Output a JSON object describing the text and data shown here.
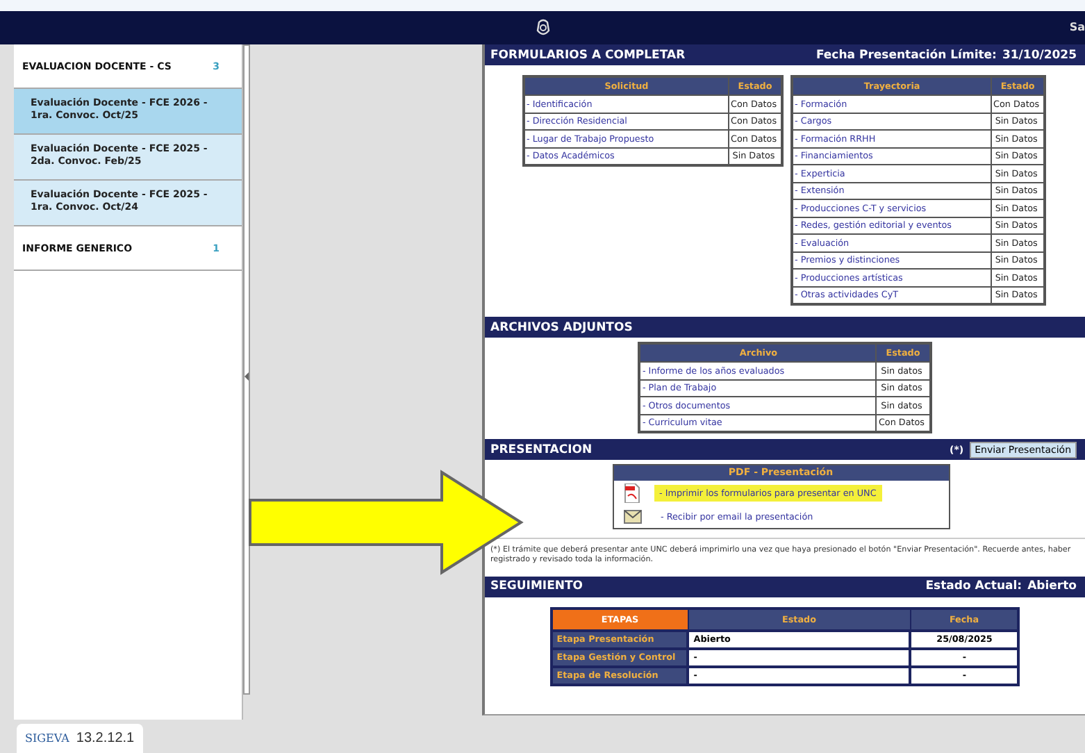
{
  "header": {
    "user_text": "Sa"
  },
  "sidebar": {
    "items": [
      {
        "kind": "group",
        "label": "EVALUACION DOCENTE - CS",
        "count": "3"
      },
      {
        "kind": "item",
        "label": "Evaluación Docente - FCE 2026 - 1ra. Convoc. Oct/25",
        "selected": true
      },
      {
        "kind": "item",
        "label": "Evaluación Docente - FCE 2025 - 2da. Convoc. Feb/25",
        "selected": false
      },
      {
        "kind": "item",
        "label": "Evaluación Docente - FCE 2025 - 1ra. Convoc. Oct/24",
        "selected": false
      },
      {
        "kind": "group",
        "label": "INFORME GENERICO",
        "count": "1"
      }
    ]
  },
  "forms": {
    "title": "FORMULARIOS A COMPLETAR",
    "deadline_label": "Fecha Presentación Límite:",
    "deadline": "31/10/2025",
    "tables": [
      {
        "columns": [
          "Solicitud",
          "Estado"
        ],
        "rows": [
          {
            "name": "- Identificación",
            "status": "Con Datos"
          },
          {
            "name": "- Dirección Residencial",
            "status": "Con Datos"
          },
          {
            "name": "- Lugar de Trabajo Propuesto",
            "status": "Con Datos"
          },
          {
            "name": "- Datos Académicos",
            "status": "Sin Datos"
          }
        ]
      },
      {
        "columns": [
          "Trayectoria",
          "Estado"
        ],
        "rows": [
          {
            "name": "- Formación",
            "status": "Con Datos"
          },
          {
            "name": "- Cargos",
            "status": "Sin Datos"
          },
          {
            "name": "- Formación RRHH",
            "status": "Sin Datos"
          },
          {
            "name": "- Financiamientos",
            "status": "Sin Datos"
          },
          {
            "name": "- Experticia",
            "status": "Sin Datos"
          },
          {
            "name": "- Extensión",
            "status": "Sin Datos"
          },
          {
            "name": "- Producciones C-T y servicios",
            "status": "Sin Datos"
          },
          {
            "name": "- Redes, gestión editorial y eventos",
            "status": "Sin Datos"
          },
          {
            "name": "- Evaluación",
            "status": "Sin Datos"
          },
          {
            "name": "- Premios y distinciones",
            "status": "Sin Datos"
          },
          {
            "name": "- Producciones artísticas",
            "status": "Sin Datos"
          },
          {
            "name": "- Otras actividades CyT",
            "status": "Sin Datos"
          }
        ]
      }
    ]
  },
  "attachments": {
    "title": "ARCHIVOS ADJUNTOS",
    "columns": [
      "Archivo",
      "Estado"
    ],
    "rows": [
      {
        "name": "- Informe de los años evaluados",
        "status": "Sin datos"
      },
      {
        "name": "- Plan de Trabajo",
        "status": "Sin datos"
      },
      {
        "name": "- Otros documentos",
        "status": "Sin datos"
      },
      {
        "name": "- Curriculum vitae",
        "status": "Con Datos"
      }
    ]
  },
  "presentation": {
    "title": "PRESENTACION",
    "note_mark": "(*)",
    "button": "Enviar Presentación",
    "box_title": "PDF - Presentación",
    "links": [
      {
        "kind": "pdf",
        "label": "- Imprimir los formularios para presentar en UNC",
        "highlighted": true
      },
      {
        "kind": "email",
        "label": "- Recibir por email la presentación",
        "highlighted": false
      }
    ]
  },
  "footnote": "(*) El trámite que deberá presentar ante UNC deberá imprimirlo una vez que haya presionado el botón \"Enviar Presentación\". Recuerde antes, haber registrado y revisado toda la información.",
  "tracking": {
    "title": "SEGUIMIENTO",
    "status_label": "Estado Actual:",
    "status": "Abierto",
    "columns": [
      "ETAPAS",
      "Estado",
      "Fecha"
    ],
    "rows": [
      [
        "Etapa Presentación",
        "Abierto",
        "25/08/2025"
      ],
      [
        "Etapa Gestión y Control",
        "-",
        "-"
      ],
      [
        "Etapa de Resolución",
        "-",
        "-"
      ]
    ]
  },
  "footer": {
    "logo": "SIGEVA",
    "version": "13.2.12.1"
  }
}
